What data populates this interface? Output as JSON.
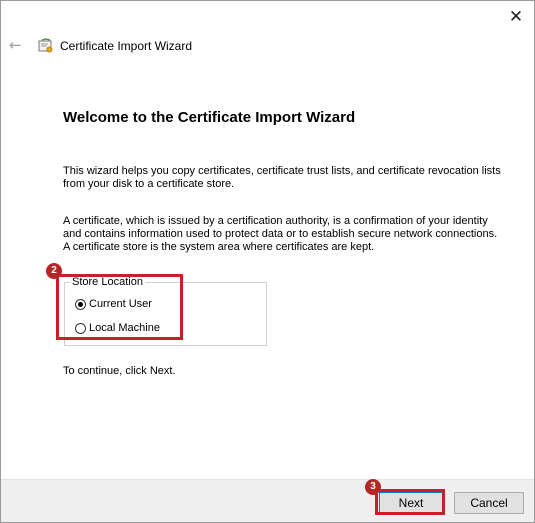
{
  "window": {
    "title": "Certificate Import Wizard",
    "close_glyph": "✕",
    "back_glyph": "←"
  },
  "content": {
    "heading": "Welcome to the Certificate Import Wizard",
    "paragraph1": "This wizard helps you copy certificates, certificate trust lists, and certificate revocation lists from your disk to a certificate store.",
    "paragraph2": "A certificate, which is issued by a certification authority, is a confirmation of your identity and contains information used to protect data or to establish secure network connections. A certificate store is the system area where certificates are kept.",
    "store_location": {
      "legend": "Store Location",
      "options": [
        {
          "label": "Current User",
          "selected": true
        },
        {
          "label": "Local Machine",
          "selected": false
        }
      ]
    },
    "continue_text": "To continue, click Next."
  },
  "annotations": {
    "badge2": "2",
    "badge3": "3",
    "color": "#c8202a"
  },
  "footer": {
    "next_label": "Next",
    "cancel_label": "Cancel"
  },
  "icons": {
    "close": "close-icon",
    "back": "back-arrow-icon",
    "certificate": "certificate-icon"
  }
}
